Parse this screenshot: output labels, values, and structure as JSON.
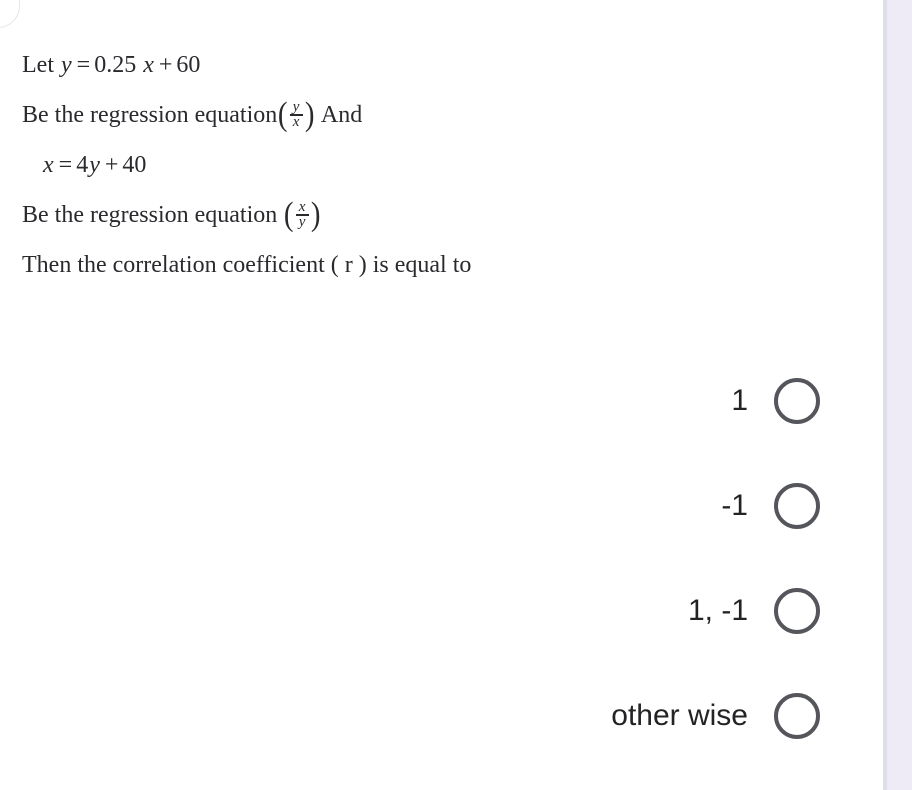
{
  "document": {
    "type": "multiple-choice-question",
    "question": {
      "line1": {
        "prefix": "Let",
        "equation": {
          "lhs": "y",
          "relation": "=",
          "coefficient": "0.25",
          "variable": "x",
          "operator": "+",
          "constant": "60"
        },
        "plain_text": "Let y = 0.25 x + 60"
      },
      "line2": {
        "text_before": "Be the regression equation",
        "fraction_numerator": "y",
        "fraction_denominator": "x",
        "text_after": "And",
        "plain_text": "Be the regression equation (y/x) And"
      },
      "line3": {
        "equation": {
          "lhs": "x",
          "relation": "=",
          "coefficient": "4",
          "variable": "y",
          "operator": "+",
          "constant": "40"
        },
        "plain_text": "x = 4y + 40"
      },
      "line4": {
        "text_before": "Be the regression equation",
        "fraction_numerator": "x",
        "fraction_denominator": "y",
        "plain_text": "Be the regression equation (x/y)"
      },
      "line5": {
        "text": "Then the correlation coefficient ( r ) is equal to"
      }
    },
    "options": [
      {
        "label": "1",
        "selected": false
      },
      {
        "label": "-1",
        "selected": false
      },
      {
        "label": "1, -1",
        "selected": false
      },
      {
        "label": "other wise",
        "selected": false
      }
    ],
    "colors": {
      "page_background": "#ffffff",
      "text": "#2a2a2e",
      "option_text": "#232326",
      "radio_border": "#55565b",
      "side_rail": "#eeebf6",
      "side_rail_divider": "#dedee6"
    }
  }
}
